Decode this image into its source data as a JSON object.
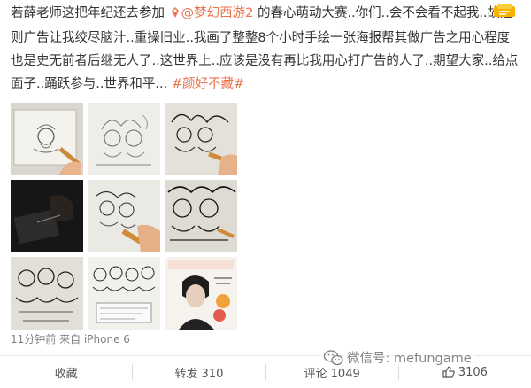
{
  "post": {
    "text_before_mention": "若薛老师这把年纪还去参加 ",
    "mention": "@梦幻西游2",
    "text_body": " 的春心萌动大赛..你们..会不会看不起我..故这则广告让我绞尽脑汁..重操旧业..我画了整整8个小时手绘一张海报帮其做广告之用心程度也是史无前者后继无人了..这世界上..应该是没有再比我用心打广告的人了..期望大家..给点面子..踊跃参与..世界和平...",
    "topic": "#颜好不藏#"
  },
  "images": [
    {
      "icon": "sketch-on-tablet"
    },
    {
      "icon": "line-sketch"
    },
    {
      "icon": "inked-drawing"
    },
    {
      "icon": "dark-photo-tablet"
    },
    {
      "icon": "drawing-with-pen"
    },
    {
      "icon": "detailed-drawing"
    },
    {
      "icon": "group-drawing"
    },
    {
      "icon": "character-lineup"
    },
    {
      "icon": "poster-portrait"
    }
  ],
  "meta": {
    "time": "11分钟前",
    "source_prefix": "来自",
    "source": "iPhone 6"
  },
  "actions": {
    "favorite": "收藏",
    "repost": "转发 310",
    "comment": "评论 1049",
    "like_count": "3106"
  },
  "watermark": {
    "text": "微信号: mefungame"
  },
  "colors": {
    "accent": "#eb7350",
    "meta": "#808080",
    "divider": "#e6e6e6"
  }
}
